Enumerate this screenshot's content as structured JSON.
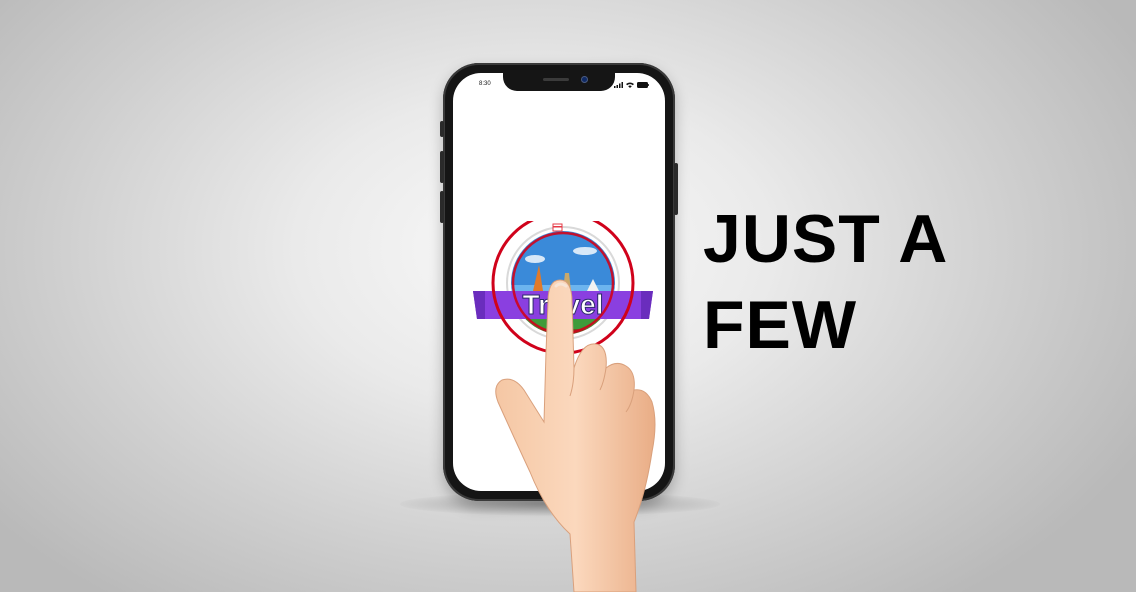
{
  "phone": {
    "status_time": "8:30"
  },
  "app": {
    "logo_text": "Travel",
    "logo_icon": "travel-globe-icon"
  },
  "headline": {
    "line1": "JUST A",
    "line2": "FEW"
  },
  "colors": {
    "logo_ring": "#d0021b",
    "logo_banner": "#8a3fe0",
    "logo_sky": "#3a8ad9",
    "text": "#000000"
  },
  "icons": [
    "signal-icon",
    "wifi-icon",
    "battery-icon",
    "tap-hand-icon",
    "tap-ripple-icon"
  ]
}
